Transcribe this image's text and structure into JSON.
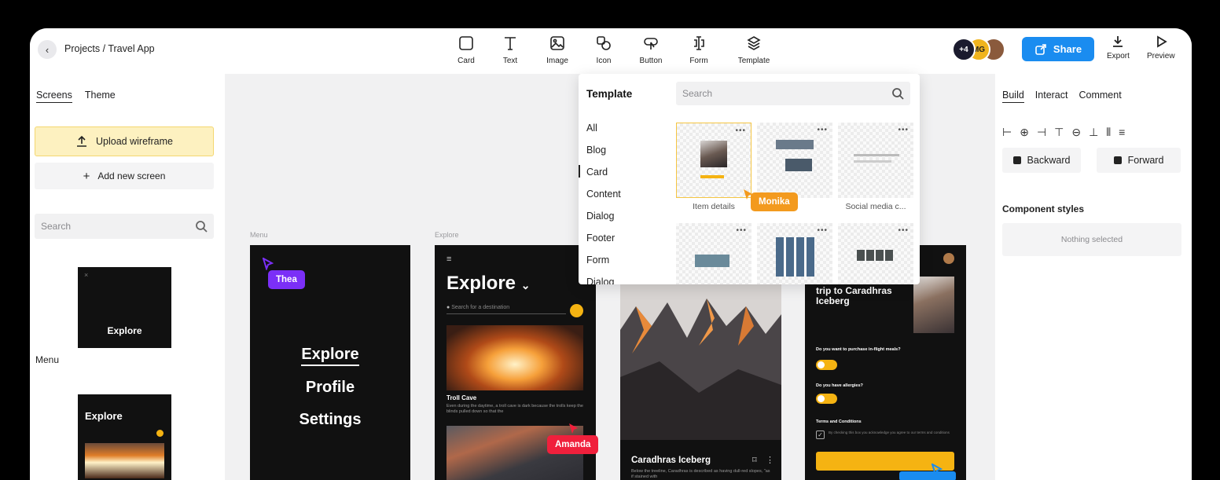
{
  "header": {
    "breadcrumb": "Projects / Travel App",
    "tools": [
      {
        "label": "Card",
        "icon": "card-icon"
      },
      {
        "label": "Text",
        "icon": "text-icon"
      },
      {
        "label": "Image",
        "icon": "image-icon"
      },
      {
        "label": "Icon",
        "icon": "icon-shapes-icon"
      },
      {
        "label": "Button",
        "icon": "button-icon"
      },
      {
        "label": "Form",
        "icon": "form-icon"
      },
      {
        "label": "Template",
        "icon": "template-icon"
      }
    ],
    "collaborators_extra": "+4",
    "collaborator_initials": "MG",
    "share_label": "Share",
    "export_label": "Export",
    "preview_label": "Preview"
  },
  "left_panel": {
    "tabs": [
      "Screens",
      "Theme"
    ],
    "upload_label": "Upload wireframe",
    "add_screen_label": "Add new screen",
    "search_placeholder": "Search",
    "thumb1_title": "Explore",
    "screen_label": "Menu",
    "thumb2_title": "Explore"
  },
  "canvas": {
    "frame_labels": [
      "Menu",
      "Explore"
    ],
    "menu_items": [
      "Explore",
      "Profile",
      "Settings"
    ],
    "explore_title": "Explore",
    "explore_search": "Search for a destination",
    "card1_title": "Troll Cave",
    "card1_desc": "Even during the daytime, a troll cave is dark because the trolls keep the blinds pulled down so that the",
    "card3_title": "Caradhras Iceberg",
    "card3_desc": "Below the treeline, Caradhras is described as having dull-red slopes, \"as if stained with",
    "card4_title": "trip to Caradhras Iceberg",
    "card4_q1": "Do you want to purchase in-flight meals?",
    "card4_q2": "Do you have allergies?",
    "card4_terms": "Terms and Conditions",
    "card4_terms_text": "By checking this box you acknowledge you agree to our terms and conditions"
  },
  "cursors": [
    {
      "name": "Thea",
      "color": "#7b2ff7"
    },
    {
      "name": "Monika",
      "color": "#f39a1e"
    },
    {
      "name": "Amanda",
      "color": "#f0203c"
    }
  ],
  "template_popover": {
    "title": "Template",
    "search_placeholder": "Search",
    "categories": [
      "All",
      "Blog",
      "Card",
      "Content",
      "Dialog",
      "Footer",
      "Form",
      "Dialog"
    ],
    "templates": [
      "Item details",
      "",
      "Social media c..."
    ]
  },
  "right_panel": {
    "tabs": [
      "Build",
      "Interact",
      "Comment"
    ],
    "backward_label": "Backward",
    "forward_label": "Forward",
    "component_styles_title": "Component styles",
    "nothing_selected": "Nothing selected"
  },
  "colors": {
    "accent_blue": "#1a8cf0",
    "highlight_yellow": "#fdf1c0",
    "brand_orange": "#f5b312"
  }
}
